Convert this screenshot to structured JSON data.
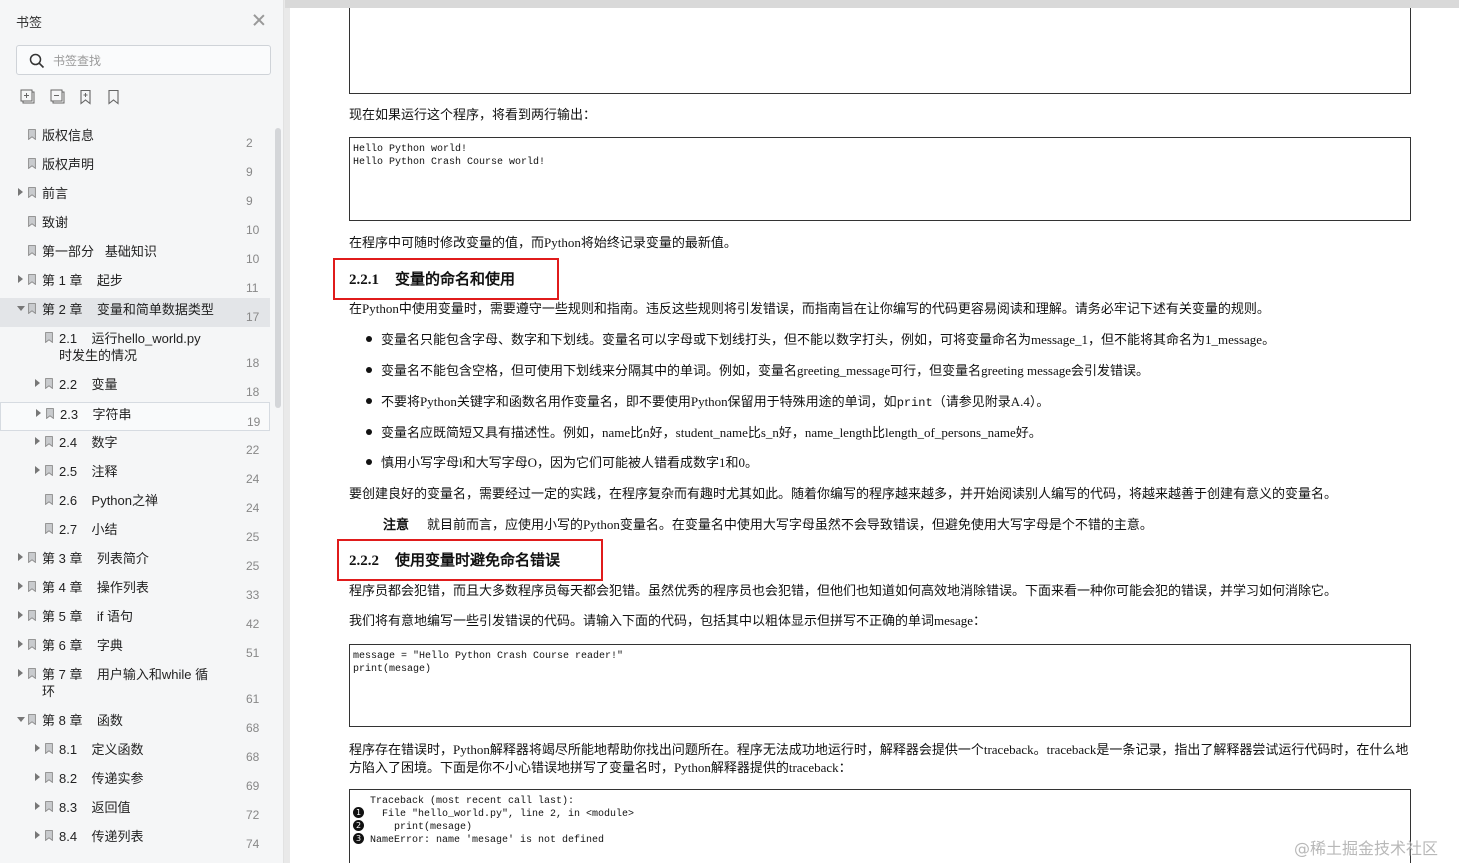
{
  "sidebar": {
    "title": "书签",
    "search_placeholder": "书签查找",
    "tool_icons": [
      "expand-all-icon",
      "collapse-all-icon",
      "add-bookmark-icon",
      "bookmark-icon"
    ],
    "items": [
      {
        "label": "版权信息",
        "page": "2",
        "level": 0,
        "arrow": "none"
      },
      {
        "label": "版权声明",
        "page": "9",
        "level": 0,
        "arrow": "none"
      },
      {
        "label": "前言",
        "page": "9",
        "level": 0,
        "arrow": "closed"
      },
      {
        "label": "致谢",
        "page": "10",
        "level": 0,
        "arrow": "none"
      },
      {
        "label": "第一部分   基础知识",
        "page": "10",
        "level": 0,
        "arrow": "none"
      },
      {
        "label": "第 1 章    起步",
        "page": "11",
        "level": 0,
        "arrow": "closed"
      },
      {
        "label": "第 2 章    变量和简单数据类型",
        "page": "17",
        "level": 0,
        "arrow": "open",
        "active": true
      },
      {
        "label": "2.1    运行hello_world.py\n时发生的情况",
        "page": "18",
        "level": 1,
        "arrow": "none",
        "tall": true
      },
      {
        "label": "2.2    变量",
        "page": "18",
        "level": 1,
        "arrow": "closed"
      },
      {
        "label": "2.3    字符串",
        "page": "19",
        "level": 1,
        "arrow": "closed",
        "hover": true
      },
      {
        "label": "2.4    数字",
        "page": "22",
        "level": 1,
        "arrow": "closed"
      },
      {
        "label": "2.5    注释",
        "page": "24",
        "level": 1,
        "arrow": "closed"
      },
      {
        "label": "2.6    Python之禅",
        "page": "24",
        "level": 1,
        "arrow": "none"
      },
      {
        "label": "2.7    小结",
        "page": "25",
        "level": 1,
        "arrow": "none"
      },
      {
        "label": "第 3 章    列表简介",
        "page": "25",
        "level": 0,
        "arrow": "closed"
      },
      {
        "label": "第 4 章    操作列表",
        "page": "33",
        "level": 0,
        "arrow": "closed"
      },
      {
        "label": "第 5 章    if 语句",
        "page": "42",
        "level": 0,
        "arrow": "closed"
      },
      {
        "label": "第 6 章    字典",
        "page": "51",
        "level": 0,
        "arrow": "closed"
      },
      {
        "label": "第 7 章    用户输入和while 循\n环",
        "page": "61",
        "level": 0,
        "arrow": "closed",
        "tall": true
      },
      {
        "label": "第 8 章    函数",
        "page": "68",
        "level": 0,
        "arrow": "open"
      },
      {
        "label": "8.1    定义函数",
        "page": "68",
        "level": 1,
        "arrow": "closed"
      },
      {
        "label": "8.2    传递实参",
        "page": "69",
        "level": 1,
        "arrow": "closed"
      },
      {
        "label": "8.3    返回值",
        "page": "72",
        "level": 1,
        "arrow": "closed"
      },
      {
        "label": "8.4    传递列表",
        "page": "74",
        "level": 1,
        "arrow": "closed"
      }
    ]
  },
  "doc": {
    "p_run": "现在如果运行这个程序，将看到两行输出：",
    "output_code": "Hello Python world!\nHello Python Crash Course world!",
    "p_modify": "在程序中可随时修改变量的值，而Python将始终记录变量的最新值。",
    "h221_num": "2.2.1",
    "h221_title": "变量的命名和使用",
    "p_rules": "在Python中使用变量时，需要遵守一些规则和指南。违反这些规则将引发错误，而指南旨在让你编写的代码更容易阅读和理解。请务必牢记下述有关变量的规则。",
    "b1": "变量名只能包含字母、数字和下划线。变量名可以字母或下划线打头，但不能以数字打头，例如，可将变量命名为message_1，但不能将其命名为1_message。",
    "b2": "变量名不能包含空格，但可使用下划线来分隔其中的单词。例如，变量名greeting_message可行，但变量名greeting message会引发错误。",
    "b3_pre": "不要将Python关键字和函数名用作变量名，即不要使用Python保留用于特殊用途的单词，如",
    "b3_code": "print",
    "b3_post": "（请参见附录A.4）。",
    "b4": "变量名应既简短又具有描述性。例如，name比n好，student_name比s_n好，name_length比length_of_persons_name好。",
    "b5": "慎用小写字母l和大写字母O，因为它们可能被人错看成数字1和0。",
    "p_create": "要创建良好的变量名，需要经过一定的实践，在程序复杂而有趣时尤其如此。随着你编写的程序越来越多，并开始阅读别人编写的代码，将越来越善于创建有意义的变量名。",
    "note_label": "注意",
    "note_text": "就目前而言，应使用小写的Python变量名。在变量名中使用大写字母虽然不会导致错误，但避免使用大写字母是个不错的主意。",
    "h222_num": "2.2.2",
    "h222_title": "使用变量时避免命名错误",
    "p_errors": "程序员都会犯错，而且大多数程序员每天都会犯错。虽然优秀的程序员也会犯错，但他们也知道如何高效地消除错误。下面来看一种你可能会犯的错误，并学习如何消除它。",
    "p_intent": "我们将有意地编写一些引发错误的代码。请输入下面的代码，包括其中以粗体显示但拼写不正确的单词mesage：",
    "code2": "message = \"Hello Python Crash Course reader!\"\nprint(mesage)",
    "p_traceback": "程序存在错误时，Python解释器将竭尽所能地帮助你找出问题所在。程序无法成功地运行时，解释器会提供一个traceback。traceback是一条记录，指出了解释器尝试运行代码时，在什么地方陷入了困境。下面是你不小心错误地拼写了变量名时，Python解释器提供的traceback：",
    "tb_lines": [
      {
        "marker": "",
        "text": "Traceback (most recent call last):"
      },
      {
        "marker": "1",
        "text": "  File \"hello_world.py\", line 2, in <module>"
      },
      {
        "marker": "2",
        "text": "    print(mesage)"
      },
      {
        "marker": "3",
        "text": "NameError: name 'mesage' is not defined"
      }
    ],
    "watermark": "@稀土掘金技术社区"
  }
}
